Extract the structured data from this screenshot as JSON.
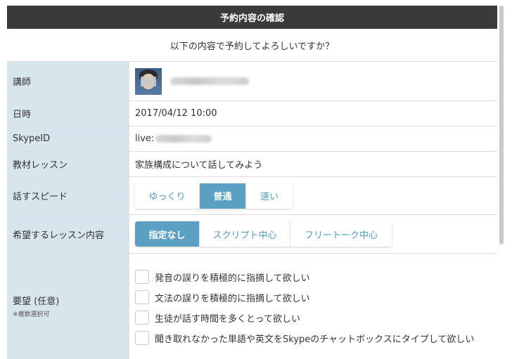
{
  "header": {
    "title": "予約内容の確認"
  },
  "subtitle": "以下の内容で予約してよろしいですか？",
  "rows": {
    "teacher": {
      "label": "講師"
    },
    "datetime": {
      "label": "日時",
      "value": "2017/04/12 10:00"
    },
    "skype": {
      "label": "SkypeID",
      "value_prefix": "live:"
    },
    "material": {
      "label": "教材レッスン",
      "value": "家族構成について話してみよう"
    },
    "speed": {
      "label": "話すスピード",
      "options": [
        "ゆっくり",
        "普通",
        "速い"
      ],
      "selected": "普通"
    },
    "content": {
      "label": "希望するレッスン内容",
      "options": [
        "指定なし",
        "スクリプト中心",
        "フリートーク中心"
      ],
      "selected": "指定なし"
    },
    "requests": {
      "label": "要望 (任意)",
      "sublabel": "※複数選択可",
      "items": [
        "発音の誤りを積極的に指摘して欲しい",
        "文法の誤りを積極的に指摘して欲しい",
        "生徒が話す時間を多くとって欲しい",
        "聞き取れなかった単語や英文をSkypeのチャットボックスにタイプして欲しい"
      ]
    }
  },
  "colors": {
    "header_bg": "#3a3a3a",
    "label_bg": "#d7e6ed",
    "accent": "#5b9fc3",
    "accent_text": "#4a9cc4"
  }
}
